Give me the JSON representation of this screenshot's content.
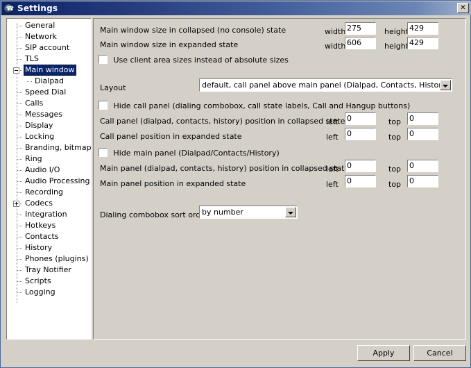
{
  "window": {
    "title": "Settings",
    "icon": "phone-icon",
    "close_label": "✕",
    "accent_color": "#0a246a",
    "face_color": "#d4d0c8"
  },
  "sidebar": {
    "items": [
      {
        "label": "General",
        "level": 0,
        "expander": "none",
        "selected": false
      },
      {
        "label": "Network",
        "level": 0,
        "expander": "none",
        "selected": false
      },
      {
        "label": "SIP account",
        "level": 0,
        "expander": "none",
        "selected": false
      },
      {
        "label": "TLS",
        "level": 0,
        "expander": "none",
        "selected": false
      },
      {
        "label": "Main window",
        "level": 0,
        "expander": "collapse",
        "selected": true
      },
      {
        "label": "Dialpad",
        "level": 1,
        "expander": "none",
        "selected": false
      },
      {
        "label": "Speed Dial",
        "level": 0,
        "expander": "none",
        "selected": false
      },
      {
        "label": "Calls",
        "level": 0,
        "expander": "none",
        "selected": false
      },
      {
        "label": "Messages",
        "level": 0,
        "expander": "none",
        "selected": false
      },
      {
        "label": "Display",
        "level": 0,
        "expander": "none",
        "selected": false
      },
      {
        "label": "Locking",
        "level": 0,
        "expander": "none",
        "selected": false
      },
      {
        "label": "Branding, bitmaps",
        "level": 0,
        "expander": "none",
        "selected": false
      },
      {
        "label": "Ring",
        "level": 0,
        "expander": "none",
        "selected": false
      },
      {
        "label": "Audio I/O",
        "level": 0,
        "expander": "none",
        "selected": false
      },
      {
        "label": "Audio Processing",
        "level": 0,
        "expander": "none",
        "selected": false
      },
      {
        "label": "Recording",
        "level": 0,
        "expander": "none",
        "selected": false
      },
      {
        "label": "Codecs",
        "level": 0,
        "expander": "expand",
        "selected": false
      },
      {
        "label": "Integration",
        "level": 0,
        "expander": "none",
        "selected": false
      },
      {
        "label": "Hotkeys",
        "level": 0,
        "expander": "none",
        "selected": false
      },
      {
        "label": "Contacts",
        "level": 0,
        "expander": "none",
        "selected": false
      },
      {
        "label": "History",
        "level": 0,
        "expander": "none",
        "selected": false
      },
      {
        "label": "Phones (plugins)",
        "level": 0,
        "expander": "none",
        "selected": false
      },
      {
        "label": "Tray Notifier",
        "level": 0,
        "expander": "none",
        "selected": false
      },
      {
        "label": "Scripts",
        "level": 0,
        "expander": "none",
        "selected": false
      },
      {
        "label": "Logging",
        "level": 0,
        "expander": "none",
        "selected": false
      }
    ]
  },
  "main": {
    "collapsed_size": {
      "label": "Main window size in collapsed (no console) state",
      "width_label": "width",
      "width_value": "275",
      "height_label": "height",
      "height_value": "429"
    },
    "expanded_size": {
      "label": "Main window size in expanded state",
      "width_label": "width",
      "width_value": "606",
      "height_label": "height",
      "height_value": "429"
    },
    "use_client_area": {
      "label": "Use client area sizes instead of absolute sizes",
      "checked": false
    },
    "layout": {
      "label": "Layout",
      "value": "default, call panel above main panel (Dialpad, Contacts, History)"
    },
    "hide_call_panel": {
      "label": "Hide call panel (dialing combobox, call state labels, Call and Hangup buttons)",
      "checked": false
    },
    "call_panel_collapsed": {
      "label": "Call panel (dialpad, contacts, history) position in collapsed state",
      "left_label": "left",
      "left_value": "0",
      "top_label": "top",
      "top_value": "0"
    },
    "call_panel_expanded": {
      "label": "Call panel position in expanded state",
      "left_label": "left",
      "left_value": "0",
      "top_label": "top",
      "top_value": "0"
    },
    "hide_main_panel": {
      "label": "Hide main panel (Dialpad/Contacts/History)",
      "checked": false
    },
    "main_panel_collapsed": {
      "label": "Main panel (dialpad, contacts, history) position in collapsed state",
      "left_label": "left",
      "left_value": "0",
      "top_label": "top",
      "top_value": "0"
    },
    "main_panel_expanded": {
      "label": "Main panel position in expanded state",
      "left_label": "left",
      "left_value": "0",
      "top_label": "top",
      "top_value": "0"
    },
    "sort_order": {
      "label": "Dialing combobox sort order",
      "value": "by number"
    }
  },
  "footer": {
    "apply_label": "Apply",
    "cancel_label": "Cancel"
  }
}
